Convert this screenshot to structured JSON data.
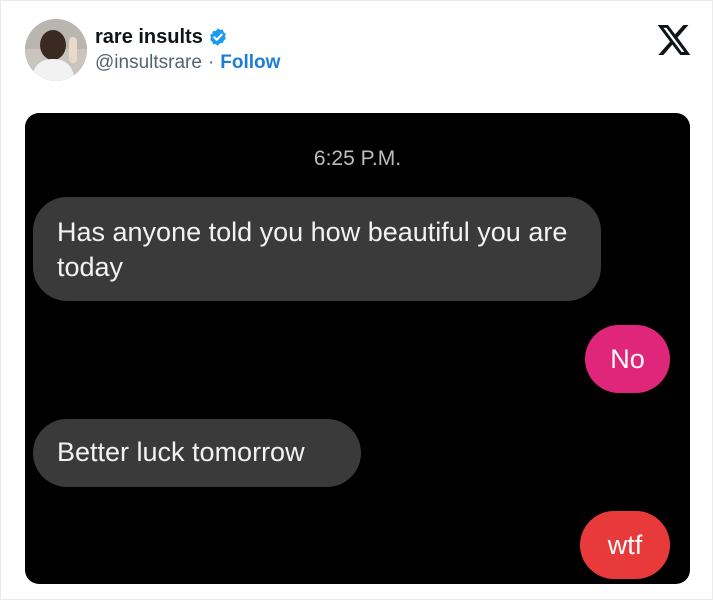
{
  "tweet": {
    "author": {
      "name": "rare insults",
      "handle": "@insultsrare",
      "separator": "·",
      "follow_label": "Follow",
      "verified_color": "#1d9bf0"
    },
    "platform_icon": "x-logo-icon",
    "media": {
      "timestamp": "6:25 P.M.",
      "messages": [
        {
          "direction": "incoming",
          "text": "Has anyone told you how beautiful you are today"
        },
        {
          "direction": "outgoing",
          "text": "No",
          "color": "#e0267a"
        },
        {
          "direction": "incoming",
          "text": "Better luck tomorrow"
        },
        {
          "direction": "outgoing",
          "text": "wtf",
          "color": "#e83a3a"
        }
      ]
    }
  }
}
